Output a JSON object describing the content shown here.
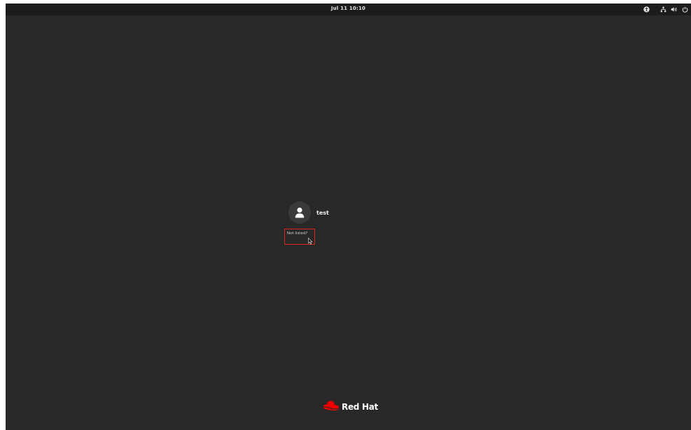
{
  "topbar": {
    "clock": "Jul 11  10:10",
    "icons": [
      "accessibility-icon",
      "network-icon",
      "volume-icon",
      "power-icon"
    ]
  },
  "login": {
    "users": [
      {
        "name": "test",
        "avatar_icon": "user-avatar-icon"
      }
    ],
    "not_listed_label": "Not listed?"
  },
  "branding": {
    "logo_text": "Red Hat",
    "logo_color": "#ee0000"
  },
  "colors": {
    "background": "#282828",
    "topbar": "#1c1c1c",
    "highlight_border": "#d9251f"
  }
}
